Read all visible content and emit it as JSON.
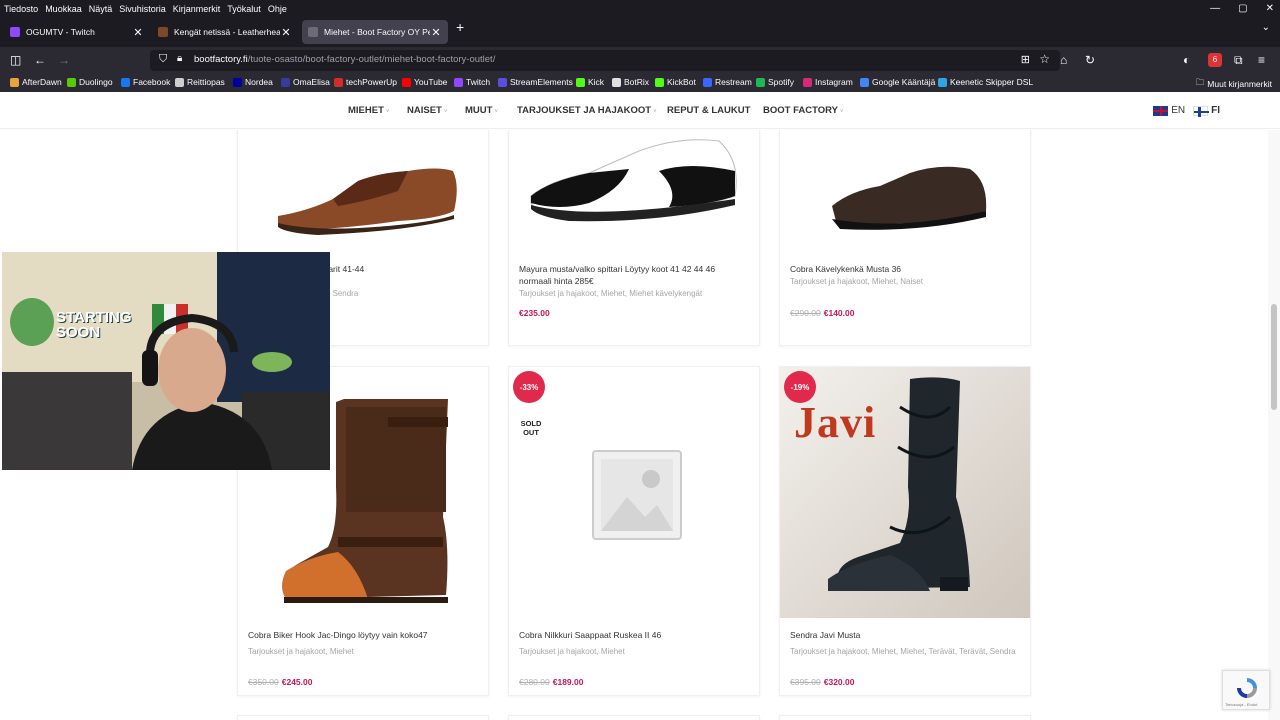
{
  "menubar": {
    "items": [
      "Tiedosto",
      "Muokkaa",
      "Näytä",
      "Sivuhistoria",
      "Kirjanmerkit",
      "Työkalut",
      "Ohje"
    ],
    "window_controls": [
      "—",
      "▢",
      "✕"
    ]
  },
  "tabs": [
    {
      "title": "OGUMTV - Twitch",
      "close": "✕"
    },
    {
      "title": "Kengät netissä - Leatherheaven",
      "close": "✕"
    },
    {
      "title": "Miehet - Boot Factory OY Pekka",
      "close": "✕"
    }
  ],
  "newtab_label": "+",
  "tablist_label": "⌄",
  "urlbar": {
    "domain": "bootfactory.fi",
    "path": "/tuote-osasto/boot-factory-outlet/miehet-boot-factory-outlet/"
  },
  "nav": {
    "sidebar": "◫",
    "back": "←",
    "forward": "→",
    "home": "⌂",
    "reload": "↻",
    "menu": "≡",
    "reader": "⊞",
    "star": "☆",
    "extensions": "⧉",
    "account": "◐",
    "badge": "6"
  },
  "bookmarks": [
    {
      "label": "AfterDawn",
      "color": "#e8a33a"
    },
    {
      "label": "Duolingo",
      "color": "#58cc02"
    },
    {
      "label": "Facebook",
      "color": "#1877f2"
    },
    {
      "label": "Reittiopas",
      "color": "#cfcfcf"
    },
    {
      "label": "Nordea",
      "color": "#0000a0"
    },
    {
      "label": "OmaElisa",
      "color": "#3a3a9a"
    },
    {
      "label": "techPowerUp",
      "color": "#d62b2b"
    },
    {
      "label": "YouTube",
      "color": "#ff0000"
    },
    {
      "label": "Twitch",
      "color": "#9146ff"
    },
    {
      "label": "StreamElements",
      "color": "#5a4ee0"
    },
    {
      "label": "Kick",
      "color": "#53fc18"
    },
    {
      "label": "BotRix",
      "color": "#e0e0e0"
    },
    {
      "label": "KickBot",
      "color": "#53fc18"
    },
    {
      "label": "Restream",
      "color": "#3a66ff"
    },
    {
      "label": "Spotify",
      "color": "#1db954"
    },
    {
      "label": "Instagram",
      "color": "#d62976"
    },
    {
      "label": "Google Kääntäjä",
      "color": "#4285f4"
    },
    {
      "label": "Keenetic Skipper DSL",
      "color": "#2fa4e7"
    }
  ],
  "bookmarks_other": "Muut kirjanmerkit",
  "site_nav": {
    "items": [
      {
        "label": "MIEHET",
        "caret": "˅"
      },
      {
        "label": "NAISET",
        "caret": "˅"
      },
      {
        "label": "MUUT",
        "caret": "˅"
      },
      {
        "label": "TARJOUKSET JA HAJAKOOT",
        "caret": "˅"
      },
      {
        "label": "REPUT & LAUKUT",
        "caret": ""
      },
      {
        "label": "BOOT FACTORY",
        "caret": "˅"
      }
    ],
    "lang_en": "EN",
    "lang_fi": "FI"
  },
  "products": [
    {
      "name": "keat Kengät tarjous parit 41-44",
      "cats": "set ja hajakoot, Miehet, Sendra",
      "old_price": "",
      "price": "",
      "badge": "",
      "sold": ""
    },
    {
      "name": "Mayura musta/valko spittari Löytyy koot 41 42 44 46 normaali hinta 285€",
      "cats": "Tarjoukset ja hajakoot, Miehet, Miehet kävelykengät",
      "old_price": "",
      "price": "€235.00",
      "badge": "",
      "sold": ""
    },
    {
      "name": "Cobra Kävelykenkä Musta 36",
      "cats": "Tarjoukset ja hajakoot, Miehet, Naiset",
      "old_price": "€290.00",
      "price": "€140.00",
      "badge": "",
      "sold": ""
    },
    {
      "name": "Cobra Biker Hook Jac-Dingo löytyy vain koko47",
      "cats": "Tarjoukset ja hajakoot, Miehet",
      "old_price": "€350.00",
      "price": "€245.00",
      "badge": "",
      "sold": ""
    },
    {
      "name": "Cobra Nilkkuri Saappaat Ruskea II 46",
      "cats": "Tarjoukset ja hajakoot, Miehet",
      "old_price": "€280.00",
      "price": "€189.00",
      "badge": "-33%",
      "sold": "SOLD OUT"
    },
    {
      "name": "Sendra Javi Musta",
      "cats": "Tarjoukset ja hajakoot, Miehet, Miehet, Terävät, Terävät, Sendra",
      "old_price": "€395.00",
      "price": "€320.00",
      "badge": "-19%",
      "sold": ""
    }
  ],
  "javi_text": "Javi",
  "recaptcha": "Tietosuoja - Ehdot"
}
